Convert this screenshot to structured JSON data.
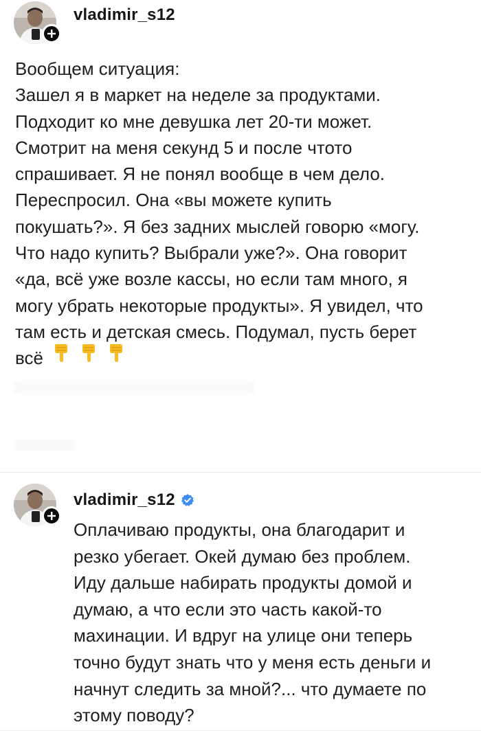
{
  "posts": [
    {
      "username": "vladimir_s12",
      "text": "Вообщем ситуация:\nЗашел я в маркет на неделе за продуктами.\nПодходит ко мне девушка лет 20-ти может.\nСмотрит на меня секунд 5 и после чтото\nспрашивает. Я не понял вообще в чем дело.\nПереспросил. Она «вы можете купить\nпокушать?». Я без задних мыслей говорю «могу.\nЧто надо купить? Выбрали уже?». Она говорит\n«да, всё уже возле кассы, но если там много, я\nмогу убрать некоторые продукты». Я увидел, что\nтам есть и детская смесь. Подумал, пусть берет\nвсё",
      "emojis": [
        "pointing-down-hand",
        "pointing-down-hand",
        "pointing-down-hand"
      ],
      "verified": false
    },
    {
      "username": "vladimir_s12",
      "text": "Оплачиваю продукты, она благодарит и\nрезко убегает. Окей думаю без проблем.\nИду дальше набирать продукты домой и\nдумаю, а что если это часть какой-то\nмахинации. И вдруг на улице они теперь\nточно будут знать что у меня есть деньги и\nначнут следить за мной?... что думаете по\nэтому поводу?",
      "verified": true
    }
  ],
  "colors": {
    "text": "#1f1f1f",
    "verified": "#3d8df5",
    "badge": "#0a0a0a",
    "emoji": "#f7bb22"
  }
}
